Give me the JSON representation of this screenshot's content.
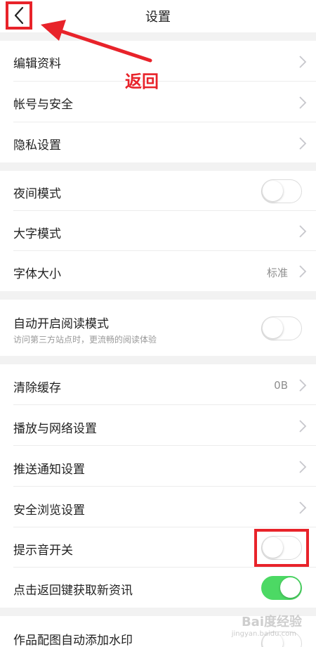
{
  "header": {
    "title": "设置",
    "back_icon": "chevron-left-icon"
  },
  "annotation": {
    "back_label": "返回",
    "color": "#e8232a"
  },
  "groups": [
    {
      "items": [
        {
          "label": "编辑资料",
          "control": "chevron"
        },
        {
          "label": "帐号与安全",
          "control": "chevron"
        },
        {
          "label": "隐私设置",
          "control": "chevron"
        }
      ]
    },
    {
      "items": [
        {
          "label": "夜间模式",
          "control": "toggle",
          "on": false
        },
        {
          "label": "大字模式",
          "control": "chevron"
        },
        {
          "label": "字体大小",
          "control": "chevron",
          "value": "标准"
        }
      ]
    },
    {
      "items": [
        {
          "label": "自动开启阅读模式",
          "sublabel": "访问第三方站点时，更流畅的阅读体验",
          "control": "toggle",
          "on": false
        }
      ]
    },
    {
      "items": [
        {
          "label": "清除缓存",
          "control": "chevron",
          "value": "0B"
        },
        {
          "label": "播放与网络设置",
          "control": "chevron"
        },
        {
          "label": "推送通知设置",
          "control": "chevron"
        },
        {
          "label": "安全浏览设置",
          "control": "chevron"
        },
        {
          "label": "提示音开关",
          "control": "toggle",
          "on": false
        },
        {
          "label": "点击返回键获取新资讯",
          "control": "toggle",
          "on": true
        }
      ]
    },
    {
      "items": [
        {
          "label": "作品配图自动添加水印",
          "control": "toggle",
          "on": false
        }
      ]
    }
  ],
  "watermark": {
    "text": "Bai度经验",
    "sub": "jingyan.baidu.com"
  },
  "colors": {
    "toggle_on": "#4cd964",
    "highlight": "#e8232a",
    "background_gap": "#f2f2f2"
  }
}
